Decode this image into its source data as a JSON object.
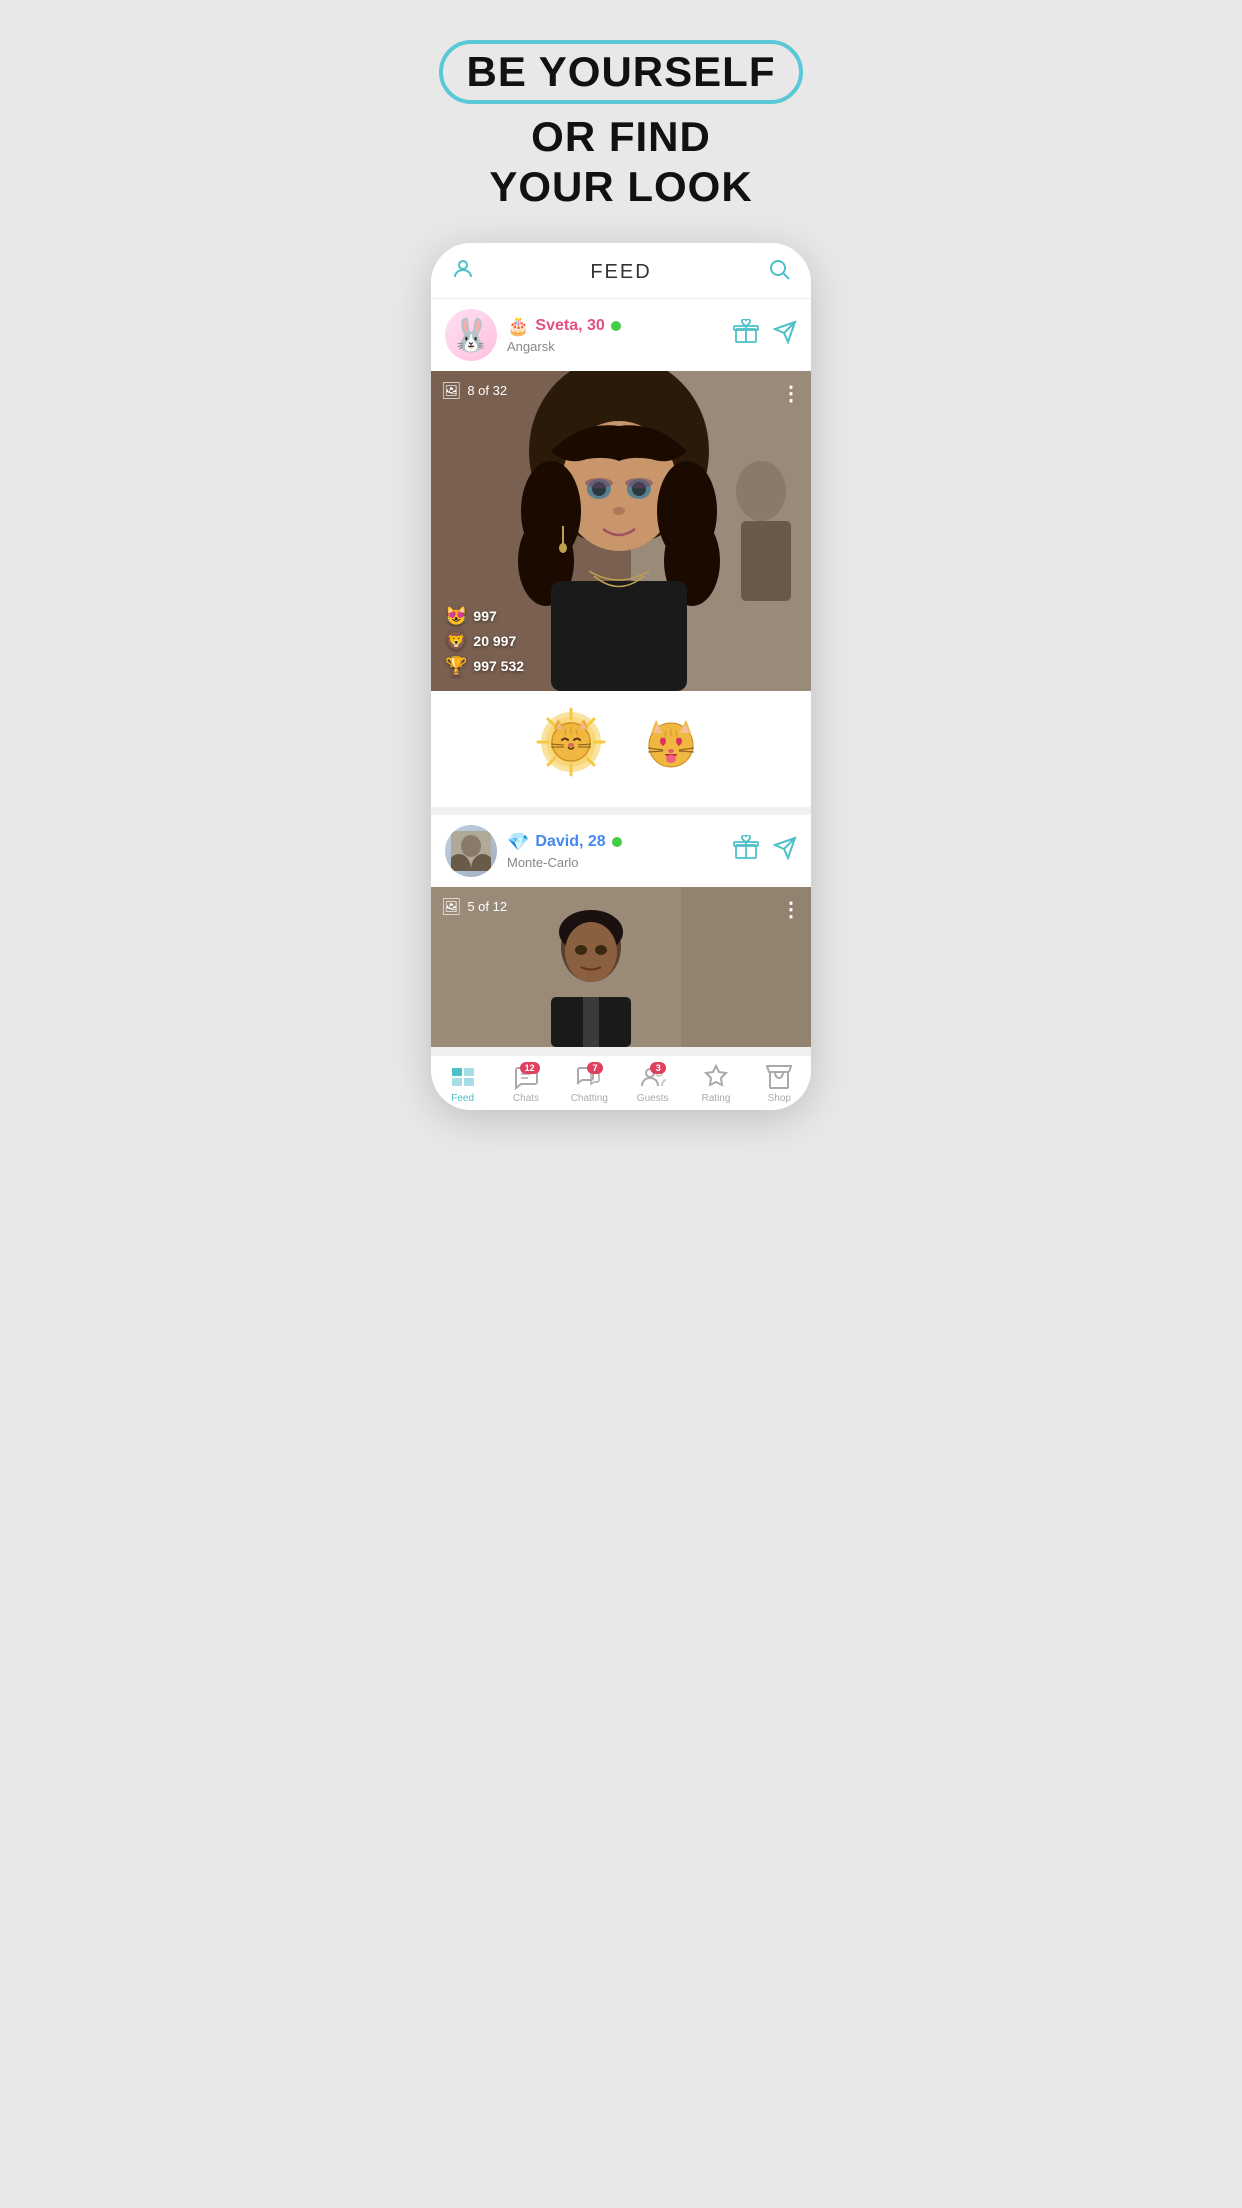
{
  "promo": {
    "line1": "BE YOURSELF",
    "line2": "OR FIND",
    "line3": "YOUR LOOK"
  },
  "header": {
    "title": "FEED",
    "profile_icon": "👤",
    "search_icon": "🔍"
  },
  "card1": {
    "user": {
      "name": "Sveta, 30",
      "badge": "🎂",
      "location": "Angarsk",
      "online": true,
      "avatar_emoji": "🐰"
    },
    "photo": {
      "counter": "8 of 32"
    },
    "stats": [
      {
        "emoji": "😻",
        "value": "997"
      },
      {
        "emoji": "🦁",
        "value": "20 997"
      },
      {
        "emoji": "🏆",
        "value": "997 532"
      }
    ],
    "stickers": [
      "🐱",
      "😻"
    ]
  },
  "card2": {
    "user": {
      "name": "David, 28",
      "badge": "💎",
      "location": "Monte-Carlo",
      "online": true,
      "avatar_emoji": "🧑"
    },
    "photo": {
      "counter": "5 of 12"
    }
  },
  "nav": {
    "items": [
      {
        "label": "Feed",
        "icon": "feed",
        "active": true,
        "badge": null
      },
      {
        "label": "Chats",
        "icon": "chats",
        "active": false,
        "badge": "12"
      },
      {
        "label": "Chatting",
        "icon": "chatting",
        "active": false,
        "badge": "7"
      },
      {
        "label": "Guests",
        "icon": "guests",
        "active": false,
        "badge": "3"
      },
      {
        "label": "Rating",
        "icon": "rating",
        "active": false,
        "badge": null
      },
      {
        "label": "Shop",
        "icon": "shop",
        "active": false,
        "badge": null
      }
    ]
  }
}
